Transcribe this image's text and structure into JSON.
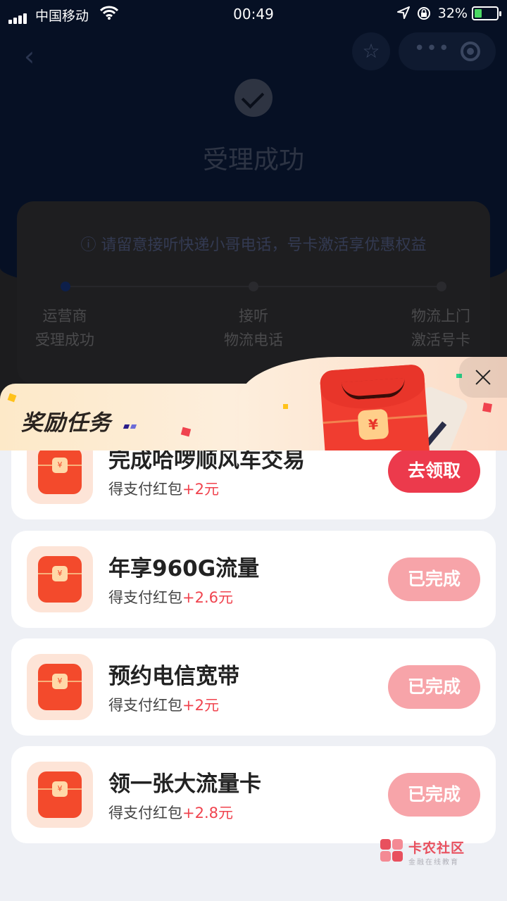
{
  "status_bar": {
    "carrier": "中国移动",
    "time": "00:49",
    "battery_percent": "32%",
    "battery_level": 0.32,
    "icons": [
      "signal-icon",
      "wifi-icon",
      "location-icon",
      "orientation-lock-icon",
      "battery-charging-icon"
    ]
  },
  "nav": {
    "back_icon": "chevron-left-icon",
    "favorite_icon": "star-icon",
    "more_icon": "more-dots-icon",
    "close_icon": "target-close-icon"
  },
  "result": {
    "title": "受理成功"
  },
  "progress": {
    "notice": "请留意接听快递小哥电话，号卡激活享优惠权益",
    "steps": [
      {
        "line1": "运营商",
        "line2": "受理成功"
      },
      {
        "line1": "接听",
        "line2": "物流电话"
      },
      {
        "line1": "物流上门",
        "line2": "激活号卡"
      }
    ]
  },
  "sheet": {
    "title": "奖励任务",
    "close_icon": "close-icon"
  },
  "tasks": [
    {
      "name": "完成哈啰顺风车交易",
      "reward_label": "得支付红包",
      "reward_amount": "+2元",
      "button": "去领取",
      "status": "active"
    },
    {
      "name": "年享960G流量",
      "reward_label": "得支付红包",
      "reward_amount": "+2.6元",
      "button": "已完成",
      "status": "done"
    },
    {
      "name": "预约电信宽带",
      "reward_label": "得支付红包",
      "reward_amount": "+2元",
      "button": "已完成",
      "status": "done"
    },
    {
      "name": "领一张大流量卡",
      "reward_label": "得支付红包",
      "reward_amount": "+2.8元",
      "button": "已完成",
      "status": "done"
    }
  ],
  "watermark": {
    "title": "卡农社区",
    "subtitle": "金融在线教育"
  },
  "colors": {
    "accent_red": "#ec3a4c",
    "done_pink": "#f7a4a9",
    "reward_red": "#f0434e",
    "dark_navy": "#061024"
  }
}
